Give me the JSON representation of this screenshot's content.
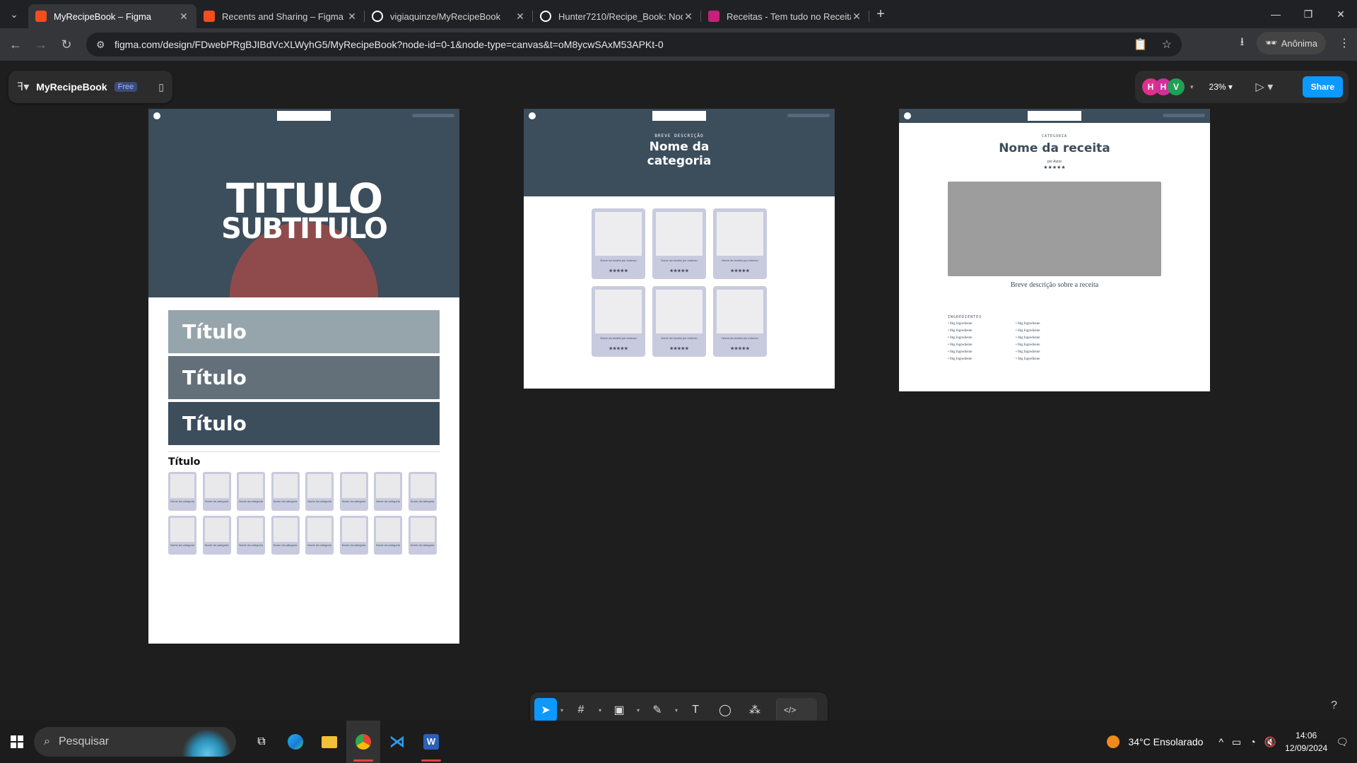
{
  "browser": {
    "tabs": [
      {
        "title": "MyRecipeBook – Figma",
        "icon": "figma-icon",
        "color": "#f24e1e",
        "active": true
      },
      {
        "title": "Recents and Sharing – Figma",
        "icon": "figma-icon",
        "color": "#f24e1e"
      },
      {
        "title": "vigiaquinze/MyRecipeBook",
        "icon": "github-icon",
        "color": "#ffffff"
      },
      {
        "title": "Hunter7210/Recipe_Book: Nod",
        "icon": "github-icon",
        "color": "#ffffff"
      },
      {
        "title": "Receitas - Tem tudo no Receitas",
        "icon": "receitas-icon",
        "color": "#c4227a"
      }
    ],
    "url": "figma.com/design/FDwebPRgBJIBdVcXLWyhG5/MyRecipeBook?node-id=0-1&node-type=canvas&t=oM8ycwSAxM53APKt-0",
    "profile": "Anônima"
  },
  "figma": {
    "file_name": "MyRecipeBook",
    "plan_badge": "Free",
    "avatars": [
      {
        "letter": "H",
        "color": "#e0308c"
      },
      {
        "letter": "H",
        "color": "#d02f9a"
      },
      {
        "letter": "V",
        "color": "#1fa055"
      }
    ],
    "zoom": "23%",
    "share_label": "Share",
    "help": "?"
  },
  "frame1": {
    "title": "TITULO",
    "subtitle": "SUBTITULO",
    "bands": [
      {
        "label": "Título",
        "color": "#96a4ab"
      },
      {
        "label": "Título",
        "color": "#63707a"
      },
      {
        "label": "Título",
        "color": "#3c4d5c"
      }
    ],
    "section_title": "Título",
    "category_label": "Nome da categoria"
  },
  "frame2": {
    "eyebrow": "BREVE DESCRIÇÃO",
    "title": "Nome da categoria",
    "card_name": "Nome da receita por extenso",
    "stars": "★★★★★"
  },
  "frame3": {
    "eyebrow": "CATEGORIA",
    "title": "Nome da receita",
    "author": "por Autor",
    "stars": "★★★★★",
    "description": "Breve descrição sobre a receita",
    "ingredients_title": "INGREDIENTES",
    "ingredient": "• 0kg Ingrediente"
  },
  "taskbar": {
    "search_placeholder": "Pesquisar",
    "weather": "34°C  Ensolarado",
    "time": "14:06",
    "date": "12/09/2024"
  }
}
